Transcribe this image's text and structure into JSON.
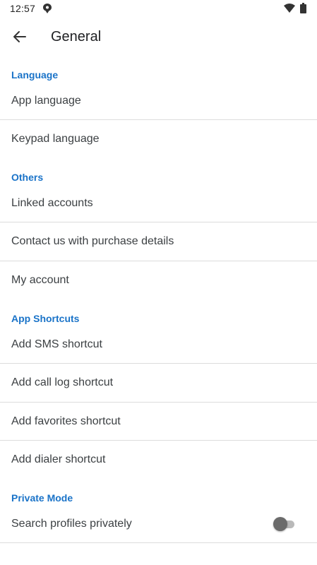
{
  "status_bar": {
    "time": "12:57",
    "icons": [
      "notification-icon",
      "wifi-icon",
      "battery-icon"
    ]
  },
  "app_bar": {
    "back_icon": "arrow-back-icon",
    "title": "General"
  },
  "sections": {
    "language": {
      "header": "Language",
      "items": [
        "App language",
        "Keypad language"
      ]
    },
    "others": {
      "header": "Others",
      "items": [
        "Linked accounts",
        "Contact us with purchase details",
        "My account"
      ]
    },
    "app_shortcuts": {
      "header": "App Shortcuts",
      "items": [
        "Add SMS shortcut",
        "Add call log shortcut",
        "Add favorites shortcut",
        "Add dialer shortcut"
      ]
    },
    "private_mode": {
      "header": "Private Mode",
      "items": [
        "Search profiles privately"
      ],
      "toggle_on": false
    }
  },
  "colors": {
    "accent": "#1a73c8",
    "divider": "#dcdcdc",
    "text": "#3c4043"
  }
}
